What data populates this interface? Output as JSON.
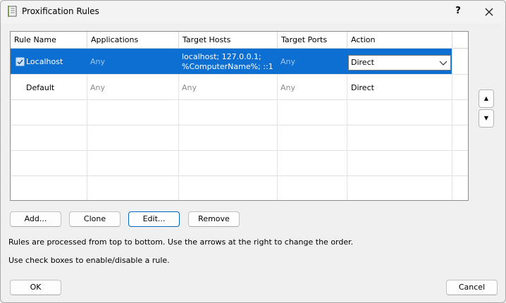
{
  "window": {
    "title": "Proxification Rules",
    "help_label": "?",
    "close_icon": "close-icon",
    "app_icon": "rules-book-icon"
  },
  "table": {
    "columns": [
      "Rule Name",
      "Applications",
      "Target Hosts",
      "Target Ports",
      "Action"
    ],
    "rows": [
      {
        "checked": true,
        "selected": true,
        "name": "Localhost",
        "applications": "Any",
        "target_hosts_line1": "localhost; 127.0.0.1;",
        "target_hosts_line2": "%ComputerName%; ::1",
        "target_ports": "Any",
        "action": "Direct"
      },
      {
        "checked": false,
        "selected": false,
        "name": "Default",
        "applications": "Any",
        "target_hosts": "Any",
        "target_ports": "Any",
        "action": "Direct"
      }
    ]
  },
  "order_buttons": {
    "up": "▲",
    "down": "▼"
  },
  "buttons": {
    "add": "Add...",
    "clone": "Clone",
    "edit": "Edit...",
    "remove": "Remove",
    "ok": "OK",
    "cancel": "Cancel"
  },
  "notes": {
    "line1": "Rules are processed from top to bottom. Use the arrows at the right to change the order.",
    "line2": "Use check boxes to enable/disable a rule."
  },
  "colors": {
    "selection": "#0e6fd3",
    "focus_border": "#0067c0"
  }
}
